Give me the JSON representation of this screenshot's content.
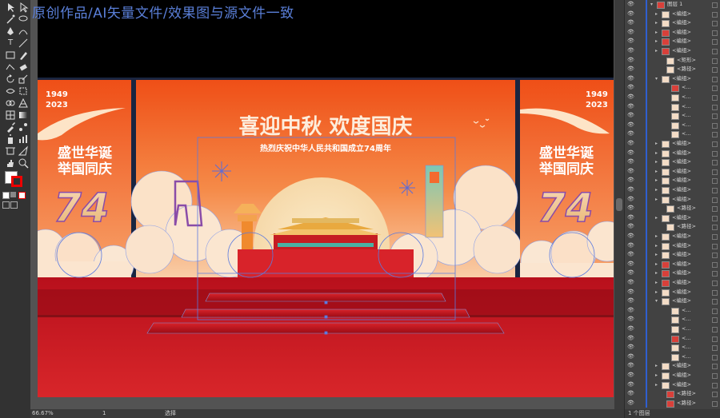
{
  "overlay": {
    "caption": "原创作品/AI矢量文件/效果图与源文件一致"
  },
  "artwork": {
    "main_title": "喜迎中秋 欢度国庆",
    "main_subtitle": "热烈庆祝中华人民共和国成立74周年",
    "left_panel": {
      "year_top": "1949",
      "year_bottom": "2023",
      "slogan_line1": "盛世华诞",
      "slogan_line2": "举国同庆",
      "big_number": "74"
    },
    "right_panel": {
      "year_top": "1949",
      "year_bottom": "2023",
      "slogan_line1": "盛世华诞",
      "slogan_line2": "举国同庆",
      "big_number": "74"
    }
  },
  "status": {
    "zoom": "66.67%",
    "page": "1",
    "tool": "选择"
  },
  "layers_panel": {
    "footer_label": "1 个图层",
    "rows": [
      {
        "name": "图层 1",
        "indent": 0,
        "expanded": true,
        "thumb": "red"
      },
      {
        "name": "<编组>",
        "indent": 1,
        "expanded": false,
        "thumb": "light"
      },
      {
        "name": "<编组>",
        "indent": 1,
        "expanded": false,
        "thumb": "light"
      },
      {
        "name": "<编组>",
        "indent": 1,
        "expanded": false,
        "thumb": "red"
      },
      {
        "name": "<编组>",
        "indent": 1,
        "expanded": false,
        "thumb": "red"
      },
      {
        "name": "<编组>",
        "indent": 1,
        "expanded": false,
        "thumb": "red"
      },
      {
        "name": "<矩形>",
        "indent": 2,
        "expanded": null,
        "thumb": "light"
      },
      {
        "name": "<路径>",
        "indent": 2,
        "expanded": null,
        "thumb": "light"
      },
      {
        "name": "<编组>",
        "indent": 1,
        "expanded": true,
        "thumb": "light"
      },
      {
        "name": "<...",
        "indent": 3,
        "expanded": null,
        "thumb": "red"
      },
      {
        "name": "<...",
        "indent": 3,
        "expanded": null,
        "thumb": "light"
      },
      {
        "name": "<...",
        "indent": 3,
        "expanded": null,
        "thumb": "light"
      },
      {
        "name": "<...",
        "indent": 3,
        "expanded": null,
        "thumb": "light"
      },
      {
        "name": "<...",
        "indent": 3,
        "expanded": null,
        "thumb": "light"
      },
      {
        "name": "<...",
        "indent": 3,
        "expanded": null,
        "thumb": "light"
      },
      {
        "name": "<编组>",
        "indent": 1,
        "expanded": false,
        "thumb": "light"
      },
      {
        "name": "<编组>",
        "indent": 1,
        "expanded": false,
        "thumb": "light"
      },
      {
        "name": "<编组>",
        "indent": 1,
        "expanded": false,
        "thumb": "light"
      },
      {
        "name": "<编组>",
        "indent": 1,
        "expanded": false,
        "thumb": "light"
      },
      {
        "name": "<编组>",
        "indent": 1,
        "expanded": false,
        "thumb": "light"
      },
      {
        "name": "<编组>",
        "indent": 1,
        "expanded": false,
        "thumb": "light"
      },
      {
        "name": "<编组>",
        "indent": 1,
        "expanded": false,
        "thumb": "light"
      },
      {
        "name": "<路径>",
        "indent": 2,
        "expanded": null,
        "thumb": "light"
      },
      {
        "name": "<编组>",
        "indent": 1,
        "expanded": false,
        "thumb": "light"
      },
      {
        "name": "<路径>",
        "indent": 2,
        "expanded": null,
        "thumb": "light"
      },
      {
        "name": "<编组>",
        "indent": 1,
        "expanded": false,
        "thumb": "light"
      },
      {
        "name": "<编组>",
        "indent": 1,
        "expanded": false,
        "thumb": "light"
      },
      {
        "name": "<编组>",
        "indent": 1,
        "expanded": false,
        "thumb": "light"
      },
      {
        "name": "<编组>",
        "indent": 1,
        "expanded": false,
        "thumb": "red"
      },
      {
        "name": "<编组>",
        "indent": 1,
        "expanded": false,
        "thumb": "red"
      },
      {
        "name": "<编组>",
        "indent": 1,
        "expanded": false,
        "thumb": "red"
      },
      {
        "name": "<编组>",
        "indent": 1,
        "expanded": false,
        "thumb": "light"
      },
      {
        "name": "<编组>",
        "indent": 1,
        "expanded": true,
        "thumb": "light"
      },
      {
        "name": "<...",
        "indent": 3,
        "expanded": null,
        "thumb": "light"
      },
      {
        "name": "<...",
        "indent": 3,
        "expanded": null,
        "thumb": "light"
      },
      {
        "name": "<...",
        "indent": 3,
        "expanded": null,
        "thumb": "light"
      },
      {
        "name": "<...",
        "indent": 3,
        "expanded": null,
        "thumb": "red"
      },
      {
        "name": "<...",
        "indent": 3,
        "expanded": null,
        "thumb": "light"
      },
      {
        "name": "<...",
        "indent": 3,
        "expanded": null,
        "thumb": "light"
      },
      {
        "name": "<编组>",
        "indent": 1,
        "expanded": false,
        "thumb": "light"
      },
      {
        "name": "<编组>",
        "indent": 1,
        "expanded": false,
        "thumb": "light"
      },
      {
        "name": "<编组>",
        "indent": 1,
        "expanded": false,
        "thumb": "light"
      },
      {
        "name": "<路径>",
        "indent": 2,
        "expanded": null,
        "thumb": "red"
      },
      {
        "name": "<路径>",
        "indent": 2,
        "expanded": null,
        "thumb": "red"
      }
    ]
  },
  "colors": {
    "accent": "#2f5fd0",
    "stage_red": "#c8141a",
    "bg_orange": "#f05a20",
    "cream": "#f7e3c2"
  }
}
